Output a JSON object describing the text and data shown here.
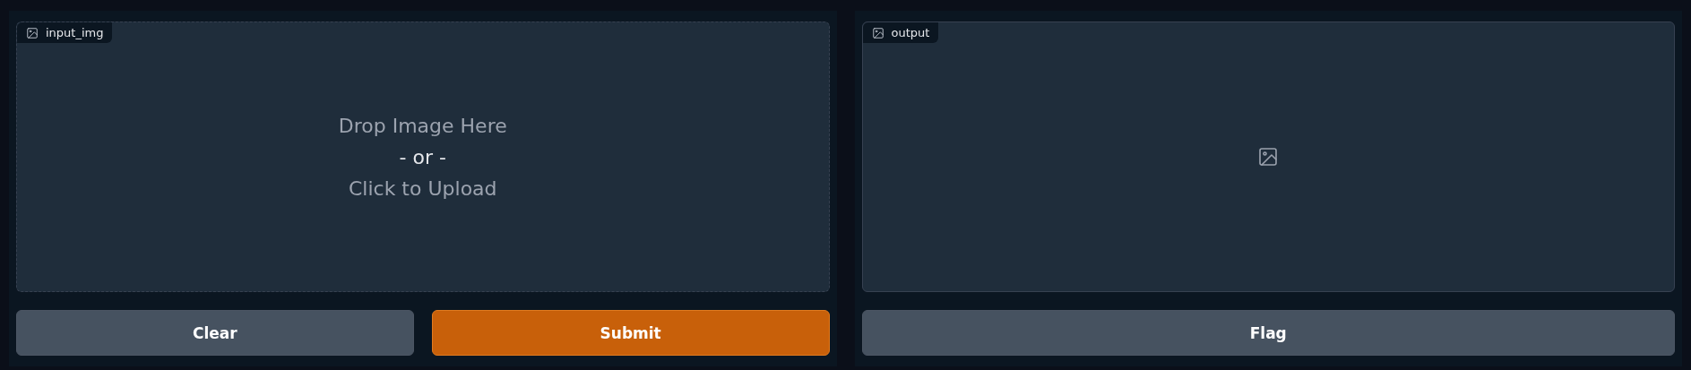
{
  "input_panel": {
    "label": "input_img",
    "drop_text": "Drop Image Here",
    "or_text": "- or -",
    "upload_text": "Click to Upload"
  },
  "buttons": [
    {
      "label": "Clear",
      "kind": "secondary"
    },
    {
      "label": "Submit",
      "kind": "primary"
    }
  ],
  "output_panel": {
    "label": "output"
  },
  "flag_button": {
    "label": "Flag",
    "kind": "secondary"
  }
}
